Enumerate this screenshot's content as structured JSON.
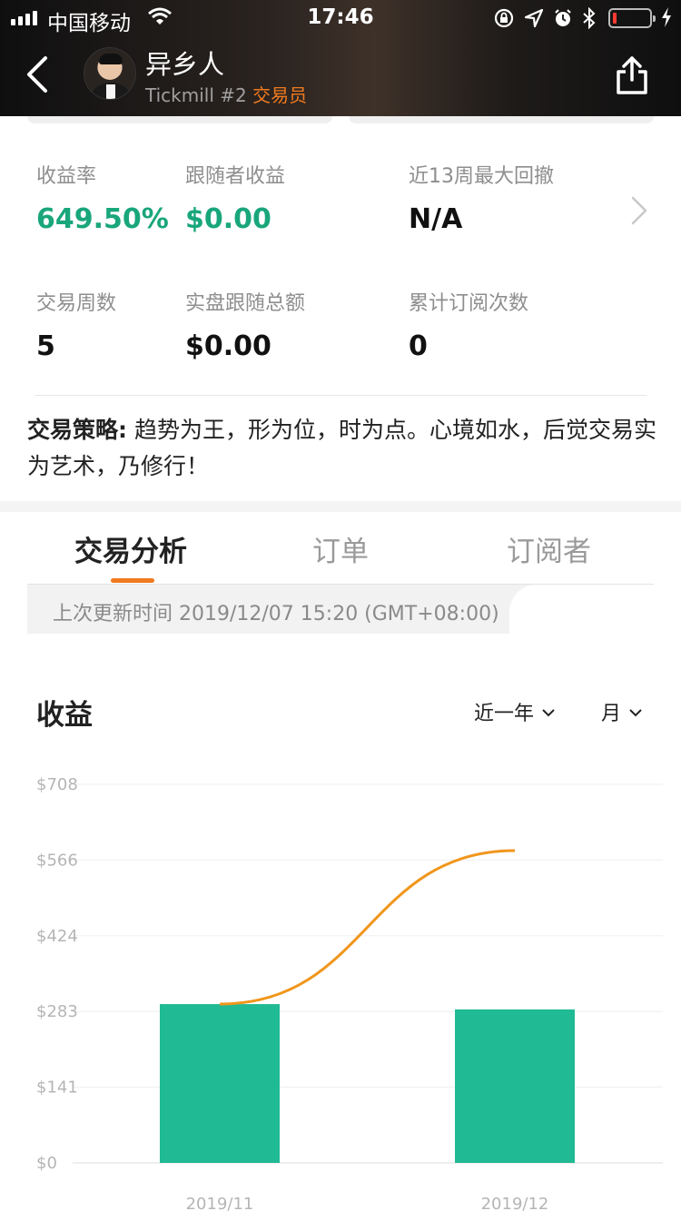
{
  "status_bar": {
    "carrier": "中国移动",
    "time": "17:46"
  },
  "header": {
    "trader_name": "异乡人",
    "broker_rank": "Tickmill #2",
    "role": "交易员"
  },
  "stats": [
    {
      "label": "收益率",
      "value": "649.50%",
      "color": "#19a67b"
    },
    {
      "label": "跟随者收益",
      "value": "$0.00",
      "color": "#19a67b"
    },
    {
      "label": "近13周最大回撤",
      "value": "N/A",
      "color": "#111111"
    },
    {
      "label": "交易周数",
      "value": "5",
      "color": "#111111"
    },
    {
      "label": "实盘跟随总额",
      "value": "$0.00",
      "color": "#111111"
    },
    {
      "label": "累计订阅次数",
      "value": "0",
      "color": "#111111"
    }
  ],
  "strategy": {
    "label": "交易策略:",
    "text": "趋势为王，形为位，时为点。心境如水，后觉交易实为艺术，乃修行！"
  },
  "tabs": [
    {
      "label": "交易分析",
      "active": true
    },
    {
      "label": "订单",
      "active": false
    },
    {
      "label": "订阅者",
      "active": false
    }
  ],
  "last_update": "上次更新时间 2019/12/07 15:20 (GMT+08:00)",
  "profit_section": {
    "title": "收益",
    "period": "近一年",
    "unit": "月"
  },
  "colors": {
    "accent": "#f07a1f",
    "positive": "#19a67b",
    "bar": "#20ba94",
    "line": "#f0961c"
  },
  "chart_data": {
    "type": "bar",
    "categories": [
      "2019/11",
      "2019/12"
    ],
    "series": [
      {
        "type": "bar",
        "values": [
          297,
          287
        ]
      },
      {
        "type": "line",
        "values": [
          297,
          584
        ]
      }
    ],
    "y_ticks": [
      "$0",
      "$141",
      "$283",
      "$424",
      "$566",
      "$708"
    ],
    "ylim": [
      0,
      708
    ],
    "grid": true
  }
}
